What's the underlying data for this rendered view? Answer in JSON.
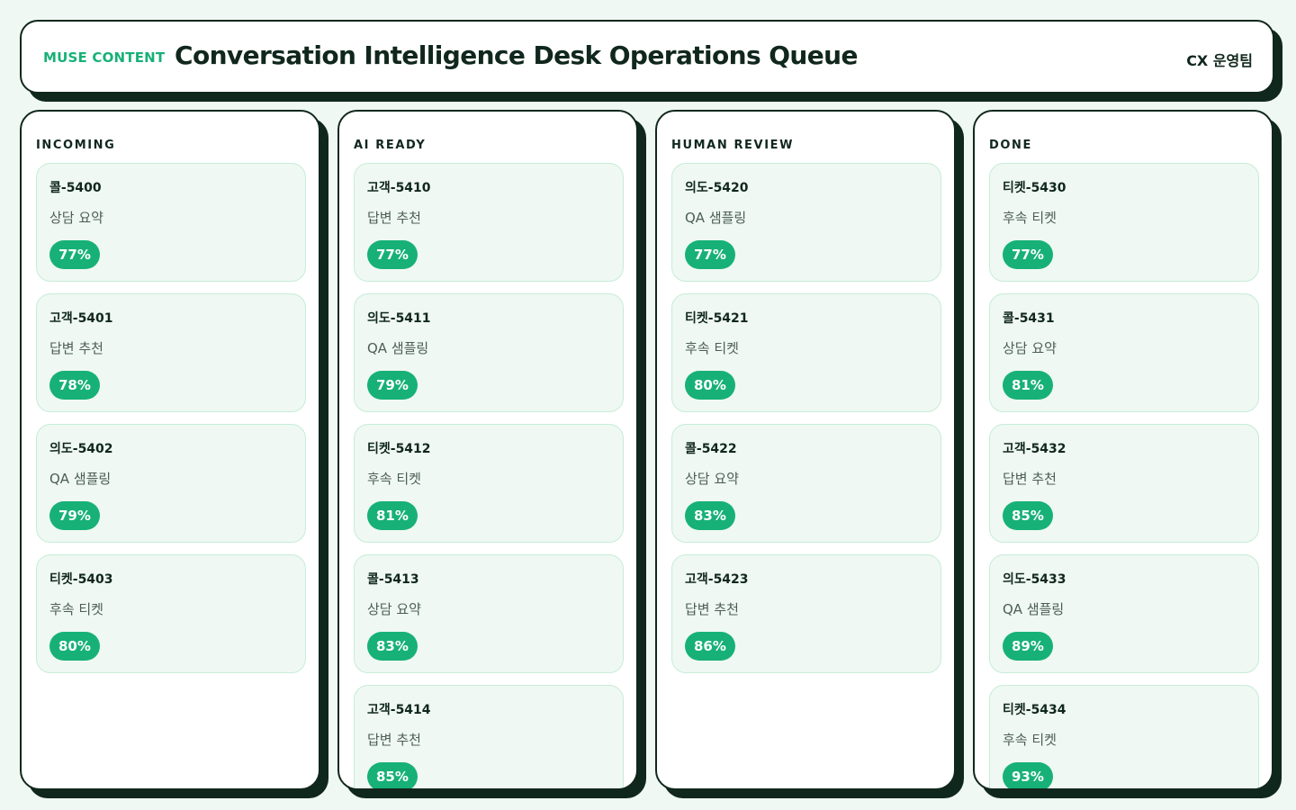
{
  "header": {
    "brand": "MUSE CONTENT",
    "title": "Conversation Intelligence Desk Operations Queue",
    "team": "CX 운영팀"
  },
  "colors": {
    "accent": "#17b177",
    "ink": "#10271d",
    "background": "#eff8f2",
    "card_border": "#c6edd8"
  },
  "columns": [
    {
      "title": "INCOMING",
      "cards": [
        {
          "id": "콜-5400",
          "label": "상담 요약",
          "score": "77%"
        },
        {
          "id": "고객-5401",
          "label": "답변 추천",
          "score": "78%"
        },
        {
          "id": "의도-5402",
          "label": "QA 샘플링",
          "score": "79%"
        },
        {
          "id": "티켓-5403",
          "label": "후속 티켓",
          "score": "80%"
        }
      ]
    },
    {
      "title": "AI READY",
      "cards": [
        {
          "id": "고객-5410",
          "label": "답변 추천",
          "score": "77%"
        },
        {
          "id": "의도-5411",
          "label": "QA 샘플링",
          "score": "79%"
        },
        {
          "id": "티켓-5412",
          "label": "후속 티켓",
          "score": "81%"
        },
        {
          "id": "콜-5413",
          "label": "상담 요약",
          "score": "83%"
        },
        {
          "id": "고객-5414",
          "label": "답변 추천",
          "score": "85%"
        }
      ]
    },
    {
      "title": "HUMAN REVIEW",
      "cards": [
        {
          "id": "의도-5420",
          "label": "QA 샘플링",
          "score": "77%"
        },
        {
          "id": "티켓-5421",
          "label": "후속 티켓",
          "score": "80%"
        },
        {
          "id": "콜-5422",
          "label": "상담 요약",
          "score": "83%"
        },
        {
          "id": "고객-5423",
          "label": "답변 추천",
          "score": "86%"
        }
      ]
    },
    {
      "title": "DONE",
      "cards": [
        {
          "id": "티켓-5430",
          "label": "후속 티켓",
          "score": "77%"
        },
        {
          "id": "콜-5431",
          "label": "상담 요약",
          "score": "81%"
        },
        {
          "id": "고객-5432",
          "label": "답변 추천",
          "score": "85%"
        },
        {
          "id": "의도-5433",
          "label": "QA 샘플링",
          "score": "89%"
        },
        {
          "id": "티켓-5434",
          "label": "후속 티켓",
          "score": "93%"
        }
      ]
    }
  ]
}
